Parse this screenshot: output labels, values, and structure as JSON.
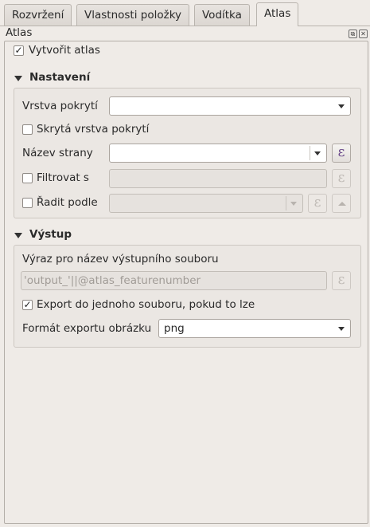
{
  "tabs": [
    {
      "label": "Rozvržení"
    },
    {
      "label": "Vlastnosti položky"
    },
    {
      "label": "Vodítka"
    },
    {
      "label": "Atlas"
    }
  ],
  "dock": {
    "title": "Atlas"
  },
  "generate": {
    "label": "Vytvořit atlas",
    "checked": true
  },
  "settings": {
    "title": "Nastavení",
    "coverage_layer_label": "Vrstva pokrytí",
    "coverage_layer_value": "",
    "hidden_layer_label": "Skrytá vrstva pokrytí",
    "page_name_label": "Název strany",
    "page_name_value": "",
    "filter_label": "Filtrovat s",
    "filter_value": "",
    "sort_label": "Řadit podle",
    "sort_value": ""
  },
  "output": {
    "title": "Výstup",
    "filename_expr_label": "Výraz pro název výstupního souboru",
    "filename_expr_value": "'output_'||@atlas_featurenumber",
    "single_file_label": "Export do jednoho souboru, pokud to lze",
    "single_file_checked": true,
    "image_format_label": "Formát exportu obrázku",
    "image_format_value": "png"
  },
  "icons": {
    "expression": "ε",
    "check": "✓"
  }
}
